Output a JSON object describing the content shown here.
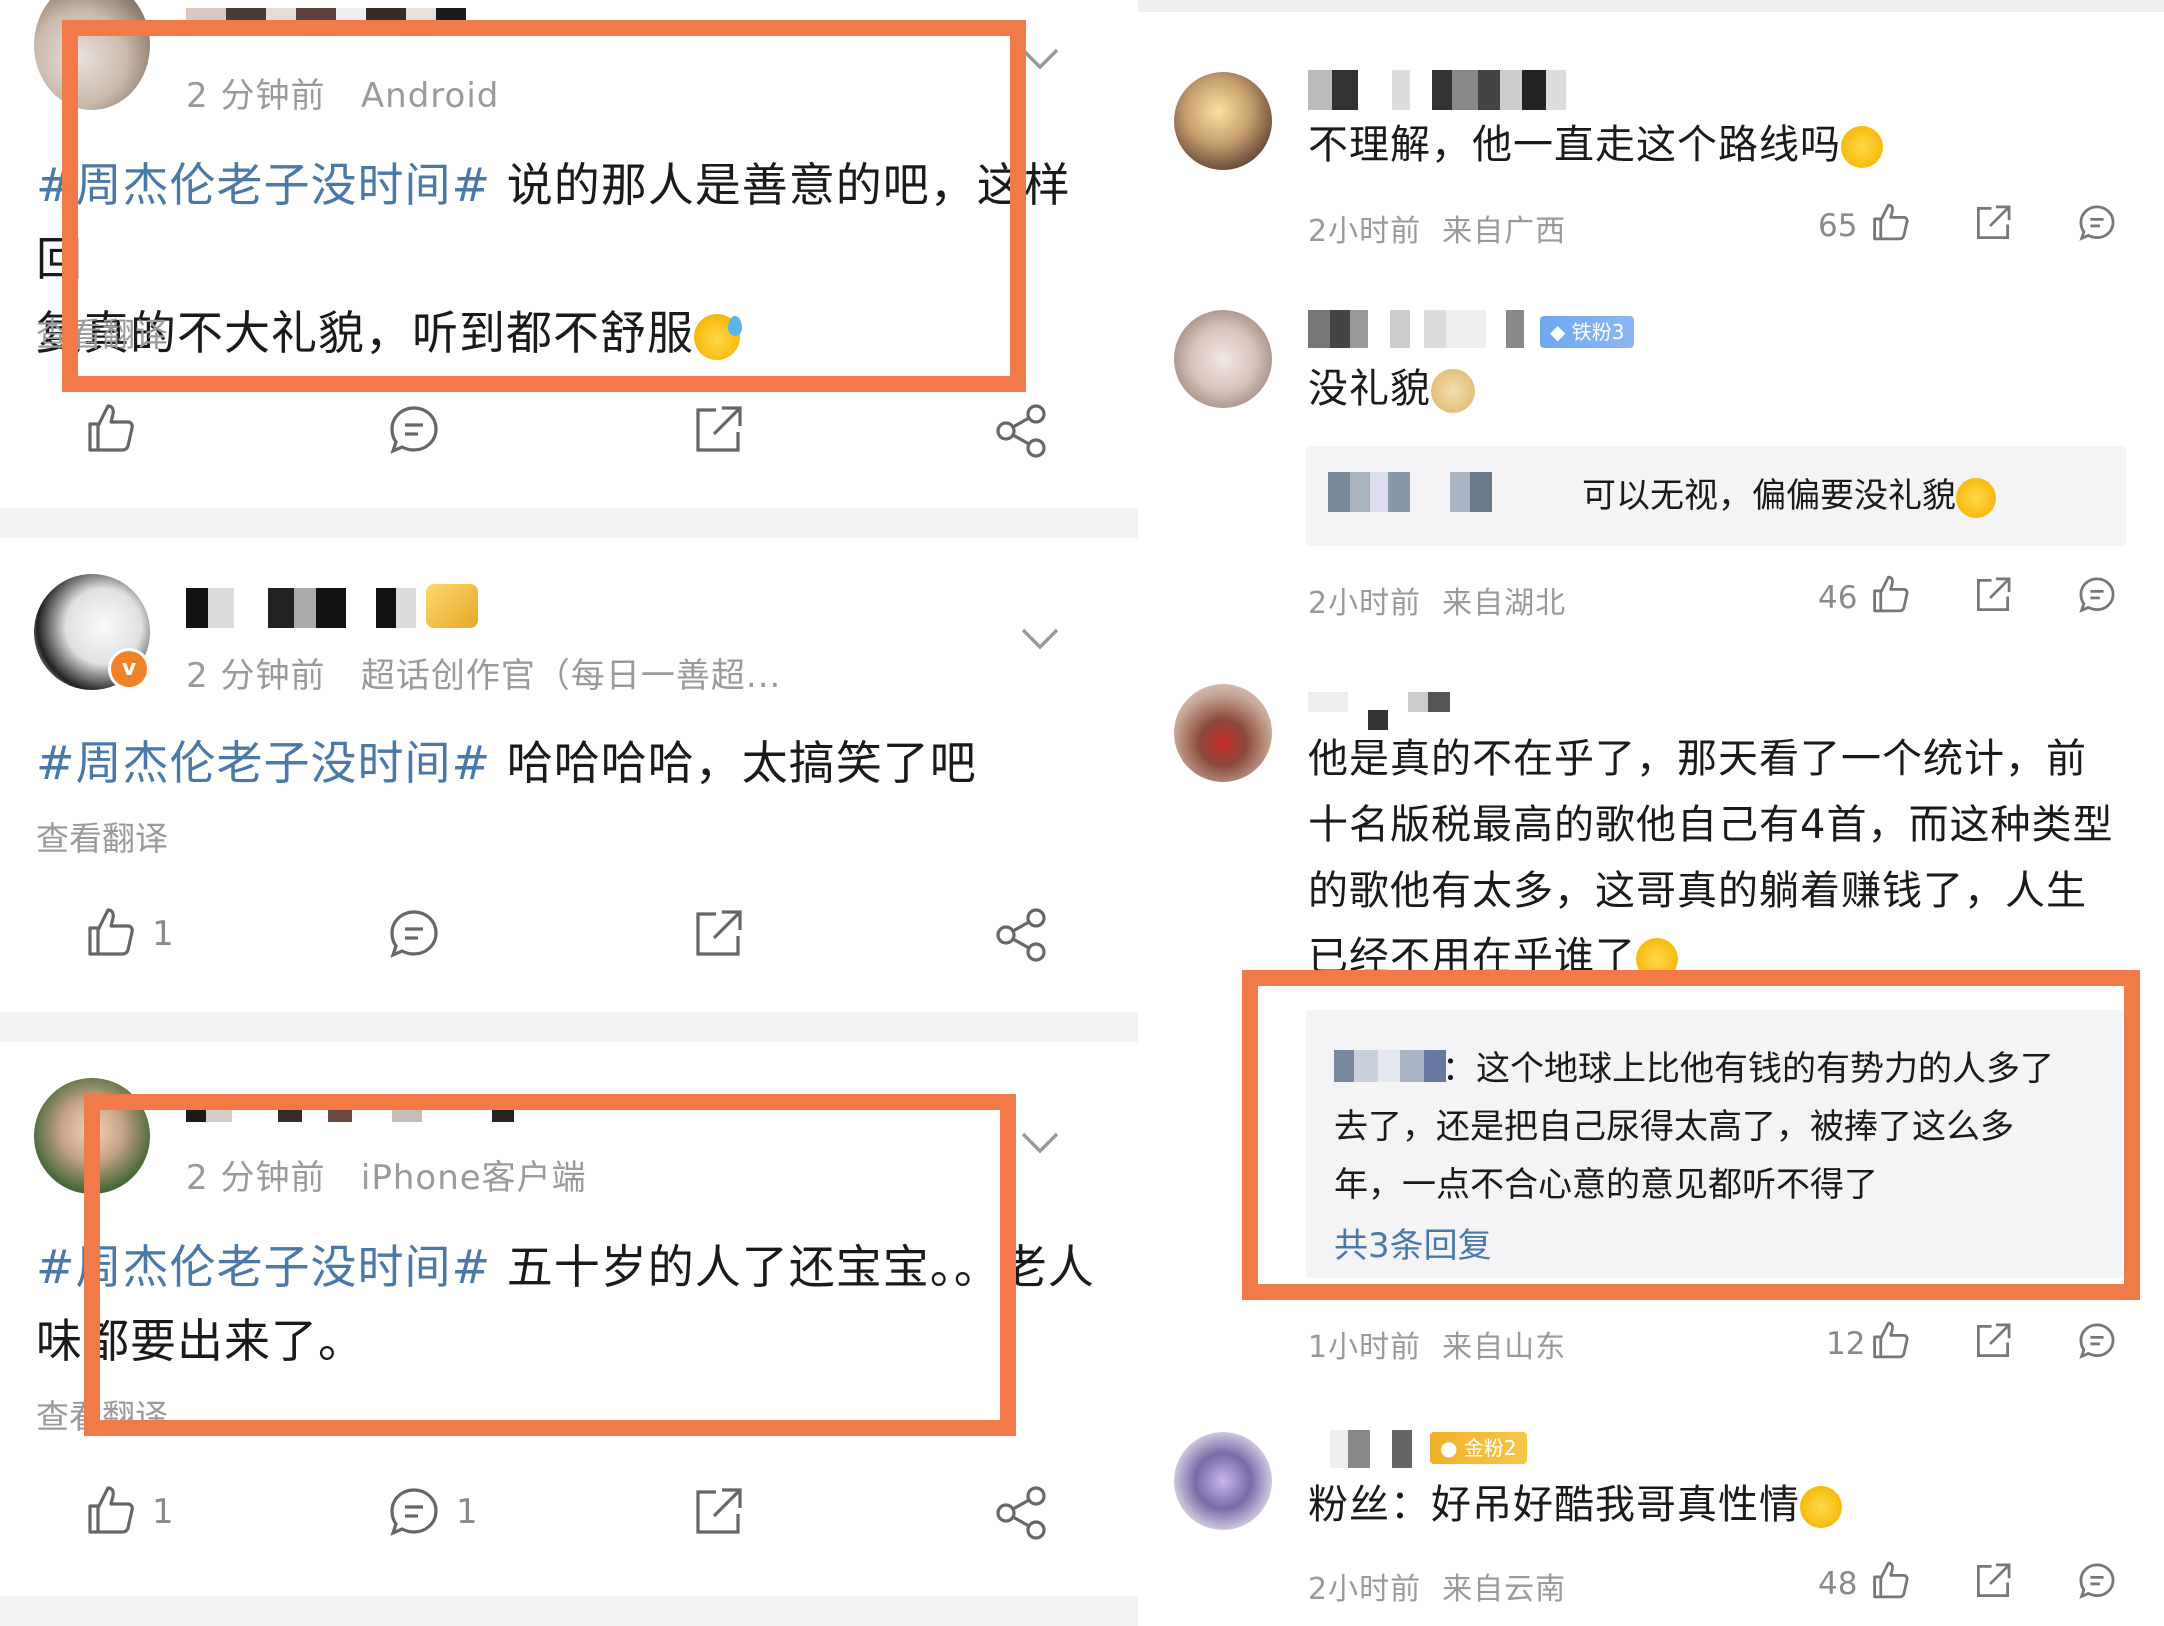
{
  "colors": {
    "hashtag": "#4a78a8",
    "highlight": "#f27a48",
    "meta": "#9a9a9a"
  },
  "left": {
    "posts": [
      {
        "time": "2 分钟前",
        "source": "Android",
        "hashtag": "#周杰伦老子没时间#",
        "text_line1": " 说的那人是善意的吧，这样回",
        "text_line2": "复真的不大礼貌，听到都不舒服",
        "translate": "查看翻译",
        "like_count": "",
        "comment_count": ""
      },
      {
        "time": "2 分钟前",
        "source": "超话创作官（每日一善超...",
        "hashtag": "#周杰伦老子没时间#",
        "text_line1": " 哈哈哈哈，太搞笑了吧",
        "text_line2": "",
        "translate": "查看翻译",
        "like_count": "1",
        "comment_count": ""
      },
      {
        "time": "2 分钟前",
        "source": "iPhone客户端",
        "hashtag": "#周杰伦老子没时间#",
        "text_line1": " 五十岁的人了还宝宝。。老人",
        "text_line2": "味都要出来了。",
        "translate": "查看翻译",
        "like_count": "1",
        "comment_count": "1"
      }
    ]
  },
  "right": {
    "comments": [
      {
        "text": "不理解，他一直走这个路线吗",
        "time": "2小时前",
        "location": "来自广西",
        "likes": "65"
      },
      {
        "badge": "铁粉3",
        "text": "没礼貌",
        "reply": "可以无视，偏偏要没礼貌",
        "time": "2小时前",
        "location": "来自湖北",
        "likes": "46"
      },
      {
        "text_lines": [
          "他是真的不在乎了，那天看了一个统计，前",
          "十名版税最高的歌他自己有4首，而这种类型",
          "的歌他有太多，这哥真的躺着赚钱了，人生",
          "已经不用在乎谁了"
        ],
        "reply_lines": [
          "：这个地球上比他有钱的有势力的人多了",
          "去了，还是把自己尿得太高了，被捧了这么多",
          "年，一点不合心意的意见都听不得了"
        ],
        "reply_more": "共3条回复",
        "time": "1小时前",
        "location": "来自山东",
        "likes": "12"
      },
      {
        "badge": "金粉2",
        "text": "粉丝：好吊好酷我哥真性情",
        "time": "2小时前",
        "location": "来自云南",
        "likes": "48"
      }
    ]
  }
}
